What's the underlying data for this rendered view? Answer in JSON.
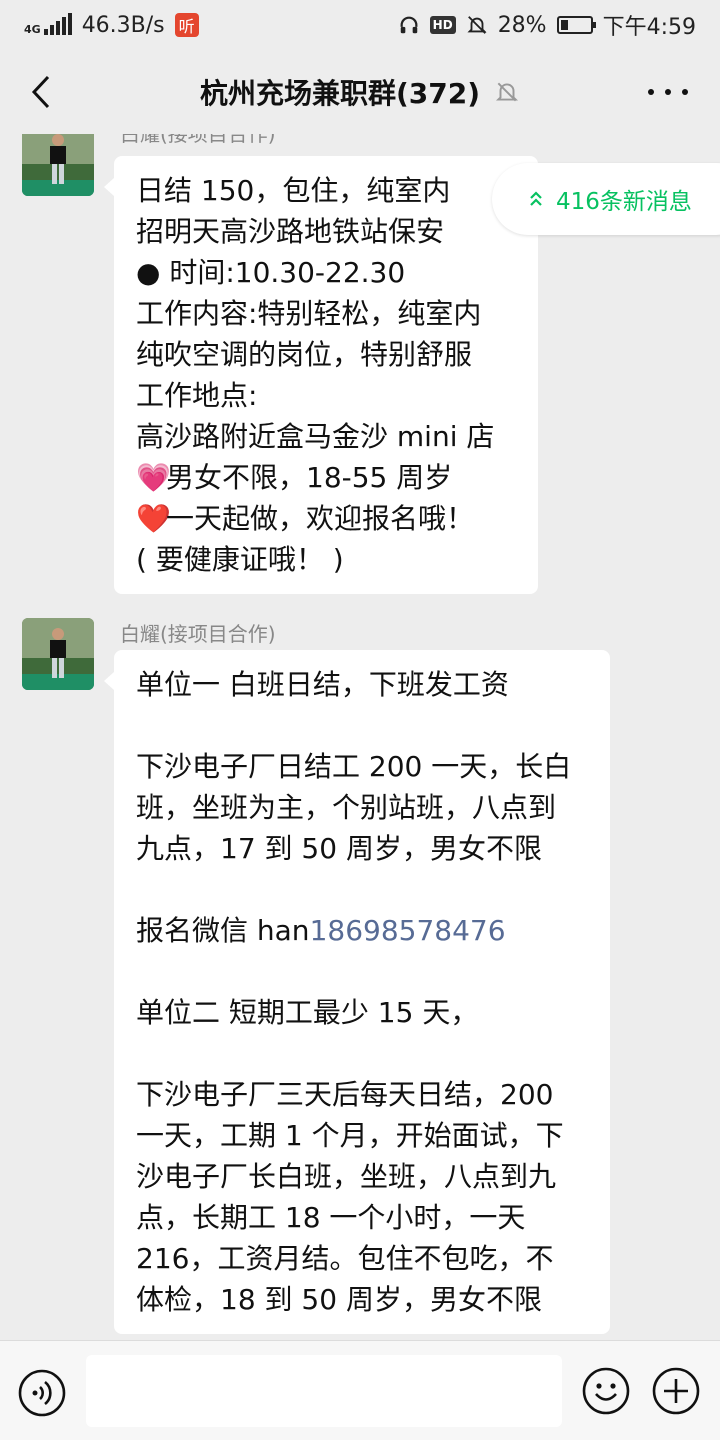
{
  "status": {
    "network_type": "4G",
    "speed": "46.3B/s",
    "app_badge": "听",
    "hd": "HD",
    "battery": "28%",
    "time": "下午4:59"
  },
  "header": {
    "title": "杭州充场兼职群(372)"
  },
  "new_messages": {
    "label": "416条新消息"
  },
  "messages": [
    {
      "sender": "白耀(接项目合作)",
      "lines": [
        "日结 150，包住，纯室内",
        "招明天高沙路地铁站保安",
        "● 时间:10.30-22.30",
        "工作内容:特别轻松，纯室内",
        "纯吹空调的岗位，特别舒服",
        "工作地点:",
        "高沙路附近盒马金沙 mini 店",
        "男女不限，18-55 周岁",
        "一天起做，欢迎报名哦！",
        "( 要健康证哦！ )"
      ],
      "emojis": [
        "💗",
        "❤️"
      ]
    },
    {
      "sender": "白耀(接项目合作)",
      "lines": [
        "单位一 白班日结，下班发工资",
        "",
        "下沙电子厂日结工 200 一天，长白",
        "班，坐班为主，个别站班，八点到",
        "九点，17 到 50 周岁，男女不限",
        "",
        "报名微信 han",
        "",
        "单位二 短期工最少 15 天，",
        "",
        "下沙电子厂三天后每天日结，200",
        "一天，工期 1 个月，开始面试，下",
        "沙电子厂长白班，坐班，八点到九",
        "点，长期工 18 一个小时，一天",
        "216，工资月结。包住不包吃，不",
        "体检，18 到 50 周岁，男女不限"
      ],
      "phone_link": "18698578476"
    }
  ],
  "input": {
    "placeholder": ""
  },
  "colors": {
    "accent": "#07c160",
    "link": "#576b95",
    "background": "#ededed"
  }
}
